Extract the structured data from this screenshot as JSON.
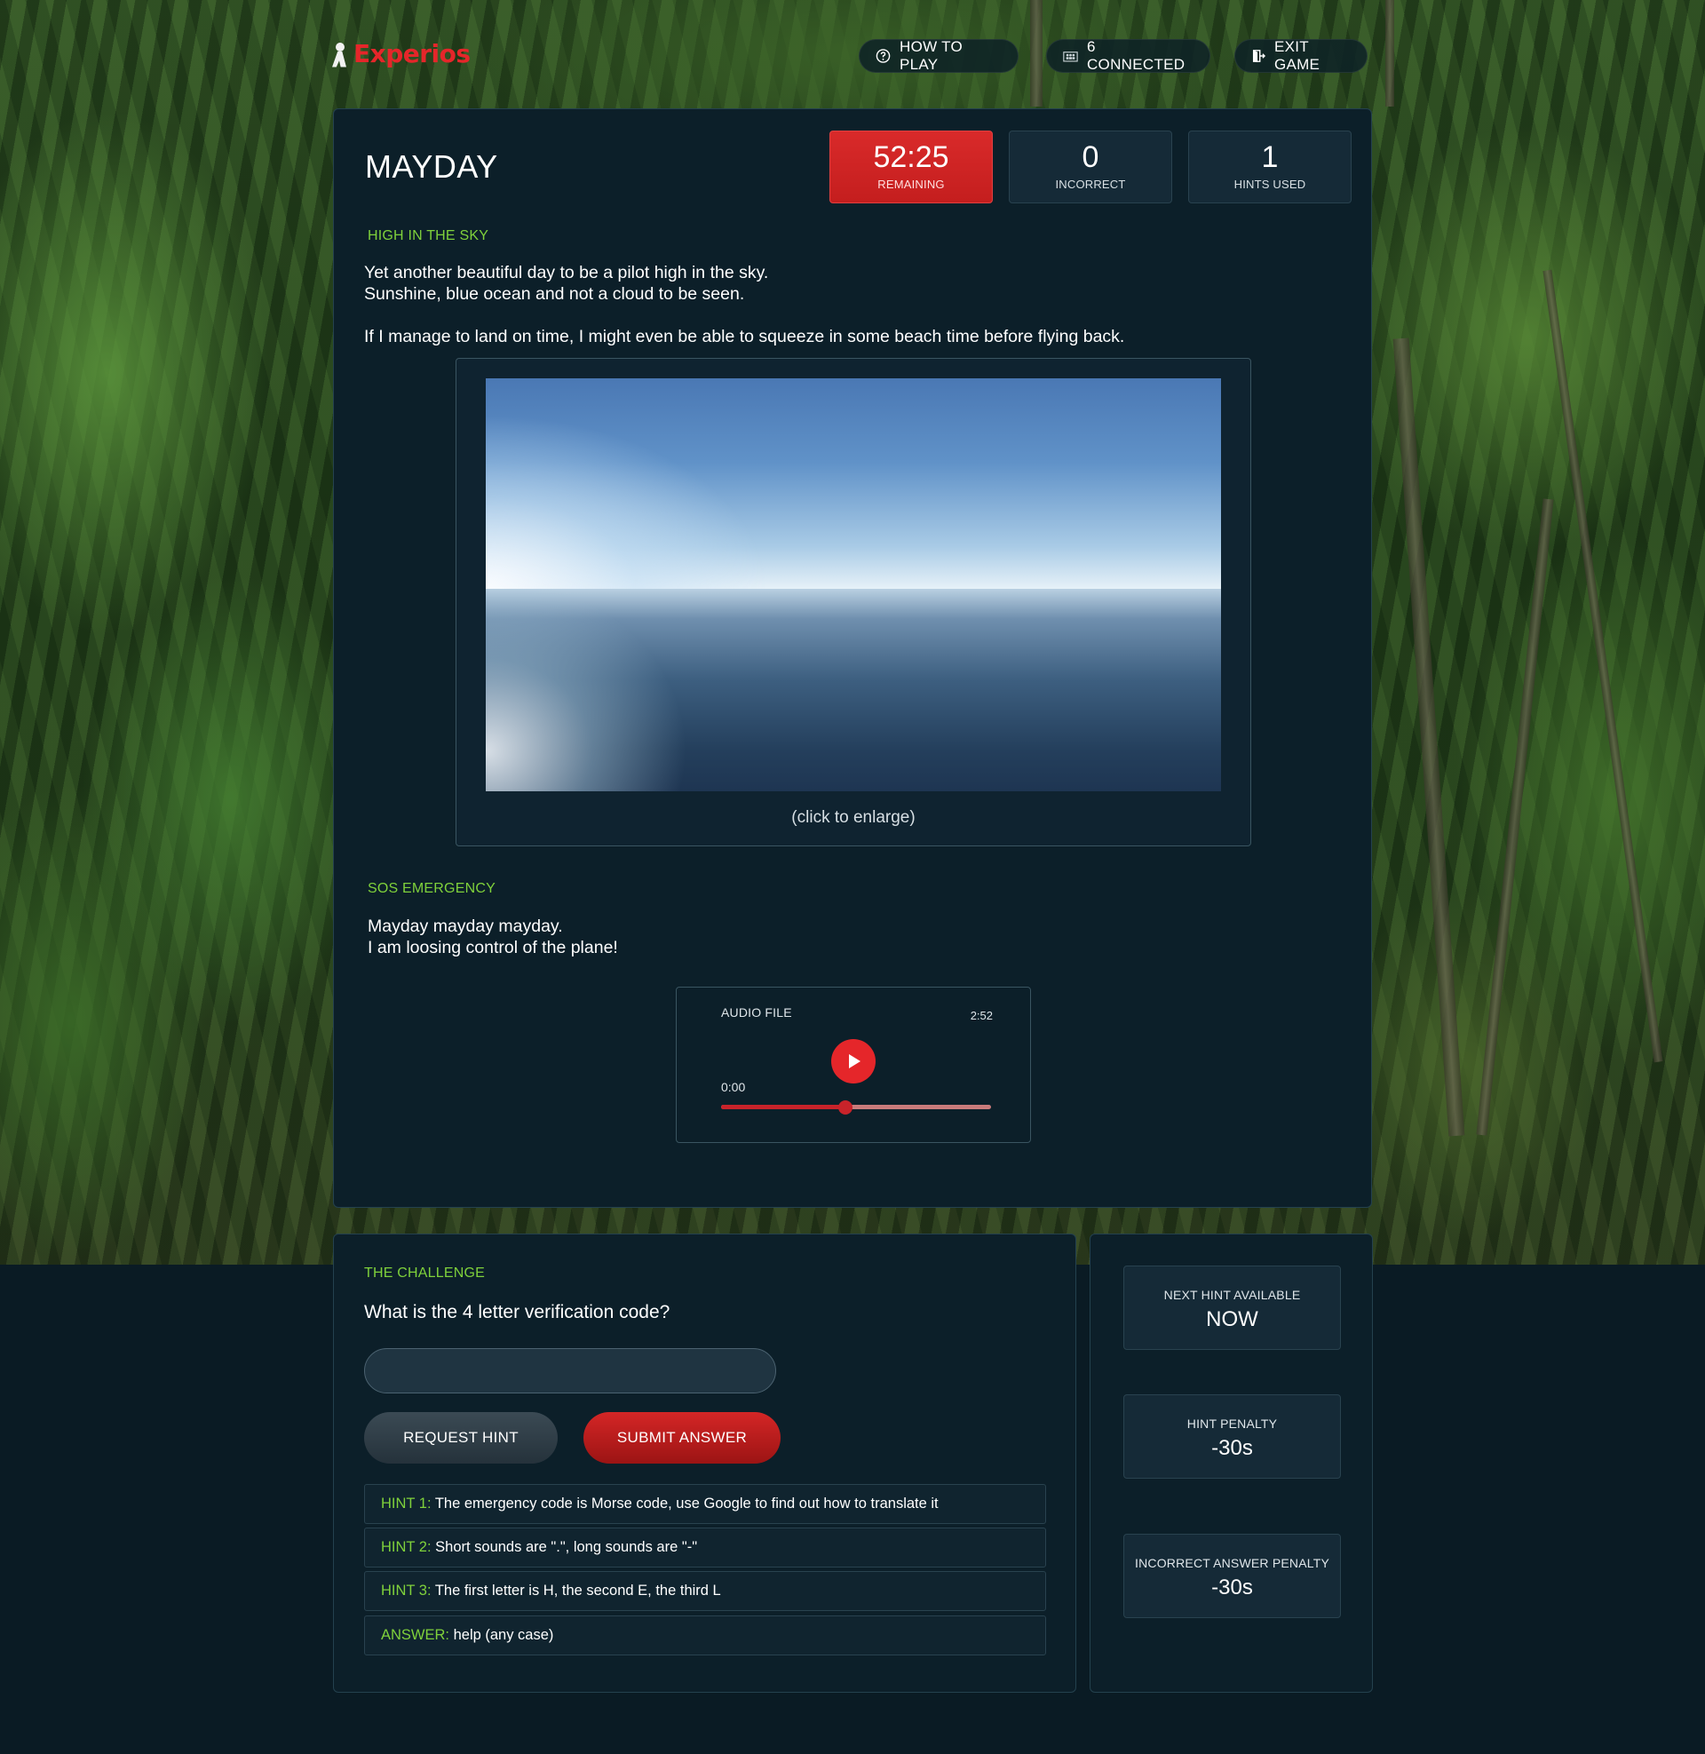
{
  "header": {
    "logo_text": "Experios",
    "how_to_play": "HOW TO PLAY",
    "connected": "6 CONNECTED",
    "exit_game": "EXIT GAME"
  },
  "puzzle": {
    "title": "MAYDAY",
    "stats": {
      "time_value": "52:25",
      "time_label": "REMAINING",
      "incorrect_value": "0",
      "incorrect_label": "INCORRECT",
      "hints_value": "1",
      "hints_label": "HINTS USED"
    },
    "section1": {
      "label": "HIGH IN THE SKY",
      "line1": "Yet another beautiful day to be a pilot high in the sky.",
      "line2": "Sunshine, blue ocean and not a cloud to be seen.",
      "line3": "If I manage to land on time, I might even be able to squeeze in some beach time before flying back.",
      "image_caption": "(click to enlarge)"
    },
    "section2": {
      "label": "SOS EMERGENCY",
      "line1": "Mayday mayday mayday.",
      "line2": "I am loosing control of the plane!"
    },
    "audio": {
      "title": "AUDIO FILE",
      "duration": "2:52",
      "current": "0:00",
      "progress": 0.46
    }
  },
  "challenge": {
    "label": "THE CHALLENGE",
    "question": "What is the 4 letter verification code?",
    "input_value": "",
    "request_hint": "REQUEST HINT",
    "submit_answer": "SUBMIT ANSWER",
    "hints": [
      {
        "key": "HINT 1:",
        "text": " The emergency code is Morse code, use Google to find out how to translate it"
      },
      {
        "key": "HINT 2:",
        "text": " Short sounds are \".\", long sounds are \"-\""
      },
      {
        "key": "HINT 3:",
        "text": " The first letter is H, the second E, the third L"
      },
      {
        "key": "ANSWER:",
        "text": " help (any case)"
      }
    ]
  },
  "hint_info": {
    "next_hint_label": "NEXT HINT AVAILABLE",
    "next_hint_value": "NOW",
    "hint_penalty_label": "HINT PENALTY",
    "hint_penalty_value": "-30s",
    "incorrect_penalty_label": "INCORRECT ANSWER PENALTY",
    "incorrect_penalty_value": "-30s"
  },
  "colors": {
    "accent_green": "#7fd13b",
    "accent_red": "#e5262a",
    "panel_bg": "#0c1f29",
    "page_bg": "#0a1b24"
  },
  "icons": {
    "how_to_play": "question-circle-icon",
    "connected": "people-icon",
    "exit": "exit-door-icon",
    "play": "play-icon"
  }
}
